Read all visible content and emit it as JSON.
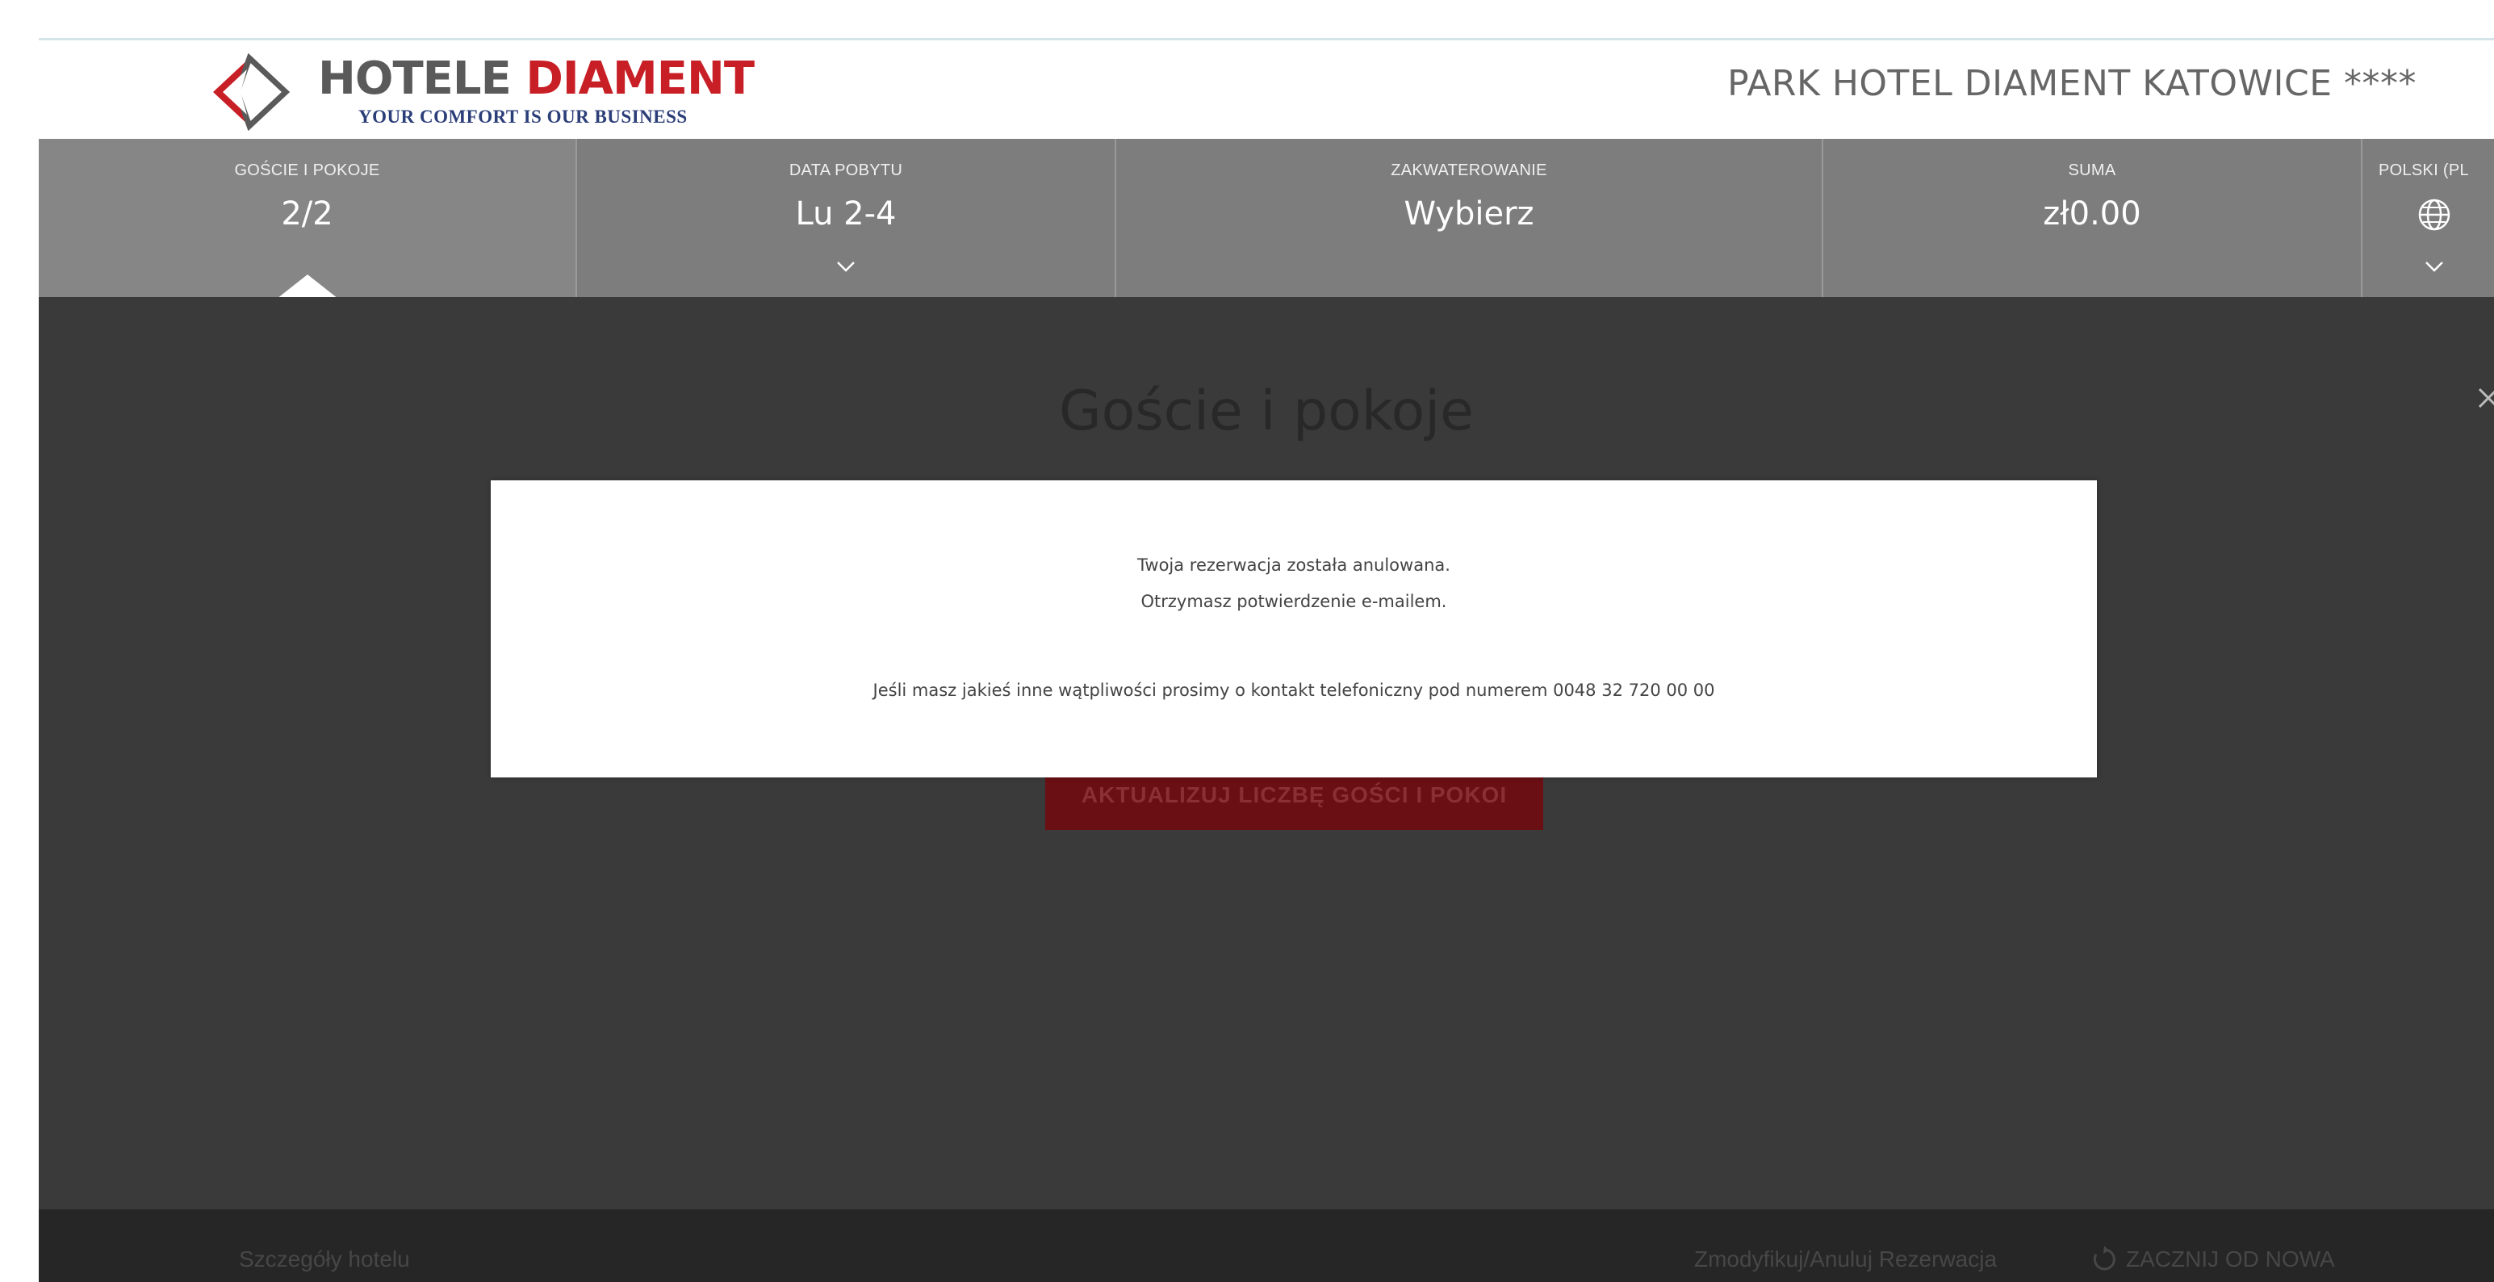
{
  "brand": {
    "logo_word1": "HOTELE ",
    "logo_word2": "DIAMENT",
    "tagline": "YOUR COMFORT IS OUR BUSINESS",
    "hotel_name": "PARK HOTEL DIAMENT KATOWICE ****",
    "colors": {
      "red": "#c81f26",
      "grey": "#5a5a5a",
      "navy": "#2b3e78"
    }
  },
  "nav": {
    "guests": {
      "label": "GOŚCIE I POKOJE",
      "value": "2/2"
    },
    "date": {
      "label": "DATA POBYTU",
      "value": "Lu 2-4"
    },
    "room": {
      "label": "ZAKWATEROWANIE",
      "value": "Wybierz"
    },
    "sum": {
      "label": "SUMA",
      "value": "zł0.00"
    },
    "lang": {
      "label": "POLSKI (PL",
      "icon": "globe-icon"
    }
  },
  "panel": {
    "title": "Goście i pokoje",
    "update_button": "AKTUALIZUJ LICZBĘ GOŚCI I POKOI"
  },
  "modal": {
    "line1": "Twoja rezerwacja została anulowana.",
    "line2": "Otrzymasz potwierdzenie e-mailem.",
    "line3": "Jeśli masz jakieś inne wątpliwości prosimy o kontakt telefoniczny pod numerem 0048 32 720 00 00"
  },
  "footer": {
    "details": "Szczegóły hotelu",
    "modify": "Zmodyfikuj/Anuluj Rezerwacja",
    "restart": "ZACZNIJ OD NOWA"
  }
}
